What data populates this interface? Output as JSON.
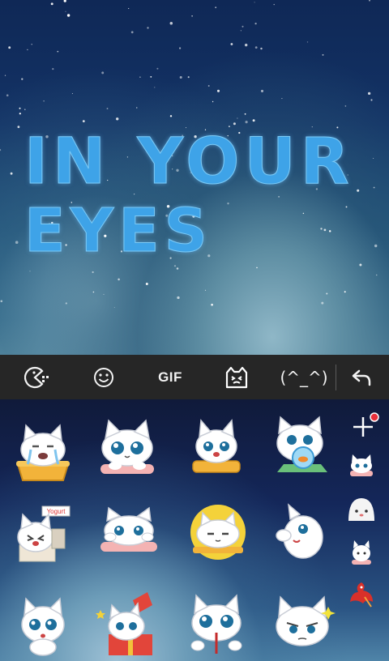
{
  "wallpaper": {
    "line1": "IN YOUR",
    "line2": "EYES"
  },
  "toolbar": {
    "tabs": [
      {
        "icon": "pacman-emoji-icon"
      },
      {
        "icon": "smiley-icon"
      },
      {
        "label": "GIF"
      },
      {
        "icon": "sticker-cat-icon",
        "selected": true
      },
      {
        "label": "(^_^)"
      },
      {
        "icon": "back-arrow-icon"
      }
    ]
  },
  "stickers": [
    {
      "icon": "cat-crying-in-bowl-sticker"
    },
    {
      "icon": "cat-big-eyes-sticker"
    },
    {
      "icon": "cat-holding-bowl-sticker"
    },
    {
      "icon": "cat-with-fish-bowl-sticker"
    },
    {
      "icon": "cat-yogurt-sign-sticker",
      "text": "Yogurt"
    },
    {
      "icon": "cat-peeking-sticker"
    },
    {
      "icon": "cat-sun-sticker"
    },
    {
      "icon": "cat-waving-sticker"
    },
    {
      "icon": "cat-surprised-sticker"
    },
    {
      "icon": "cat-gift-box-sticker"
    },
    {
      "icon": "cat-crying-sticker"
    },
    {
      "icon": "cat-grumpy-sticker"
    }
  ],
  "side_pack": [
    {
      "icon": "add-pack-icon"
    },
    {
      "icon": "cat-pack-icon"
    },
    {
      "icon": "ghost-pack-icon"
    },
    {
      "icon": "cat-white-pack-icon"
    },
    {
      "icon": "dragon-pack-icon"
    }
  ],
  "colors": {
    "toolbar_bg": "#262626",
    "title_blue": "#3ea3e8",
    "notify_red": "#e8303a"
  }
}
